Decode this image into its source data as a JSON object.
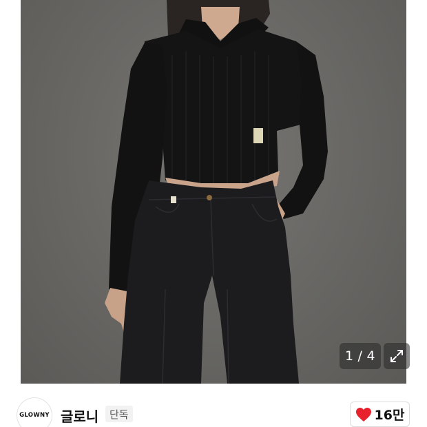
{
  "gallery": {
    "current_page": "1",
    "total_pages": "4",
    "separator": "/",
    "image_icon": "product-photo",
    "expand_icon": "expand-icon"
  },
  "brand": {
    "logo_text": "GLOWNY",
    "name": "글로니",
    "badge": "단독"
  },
  "like": {
    "icon": "heart-icon",
    "count": "16만",
    "color": "#e8222c"
  }
}
